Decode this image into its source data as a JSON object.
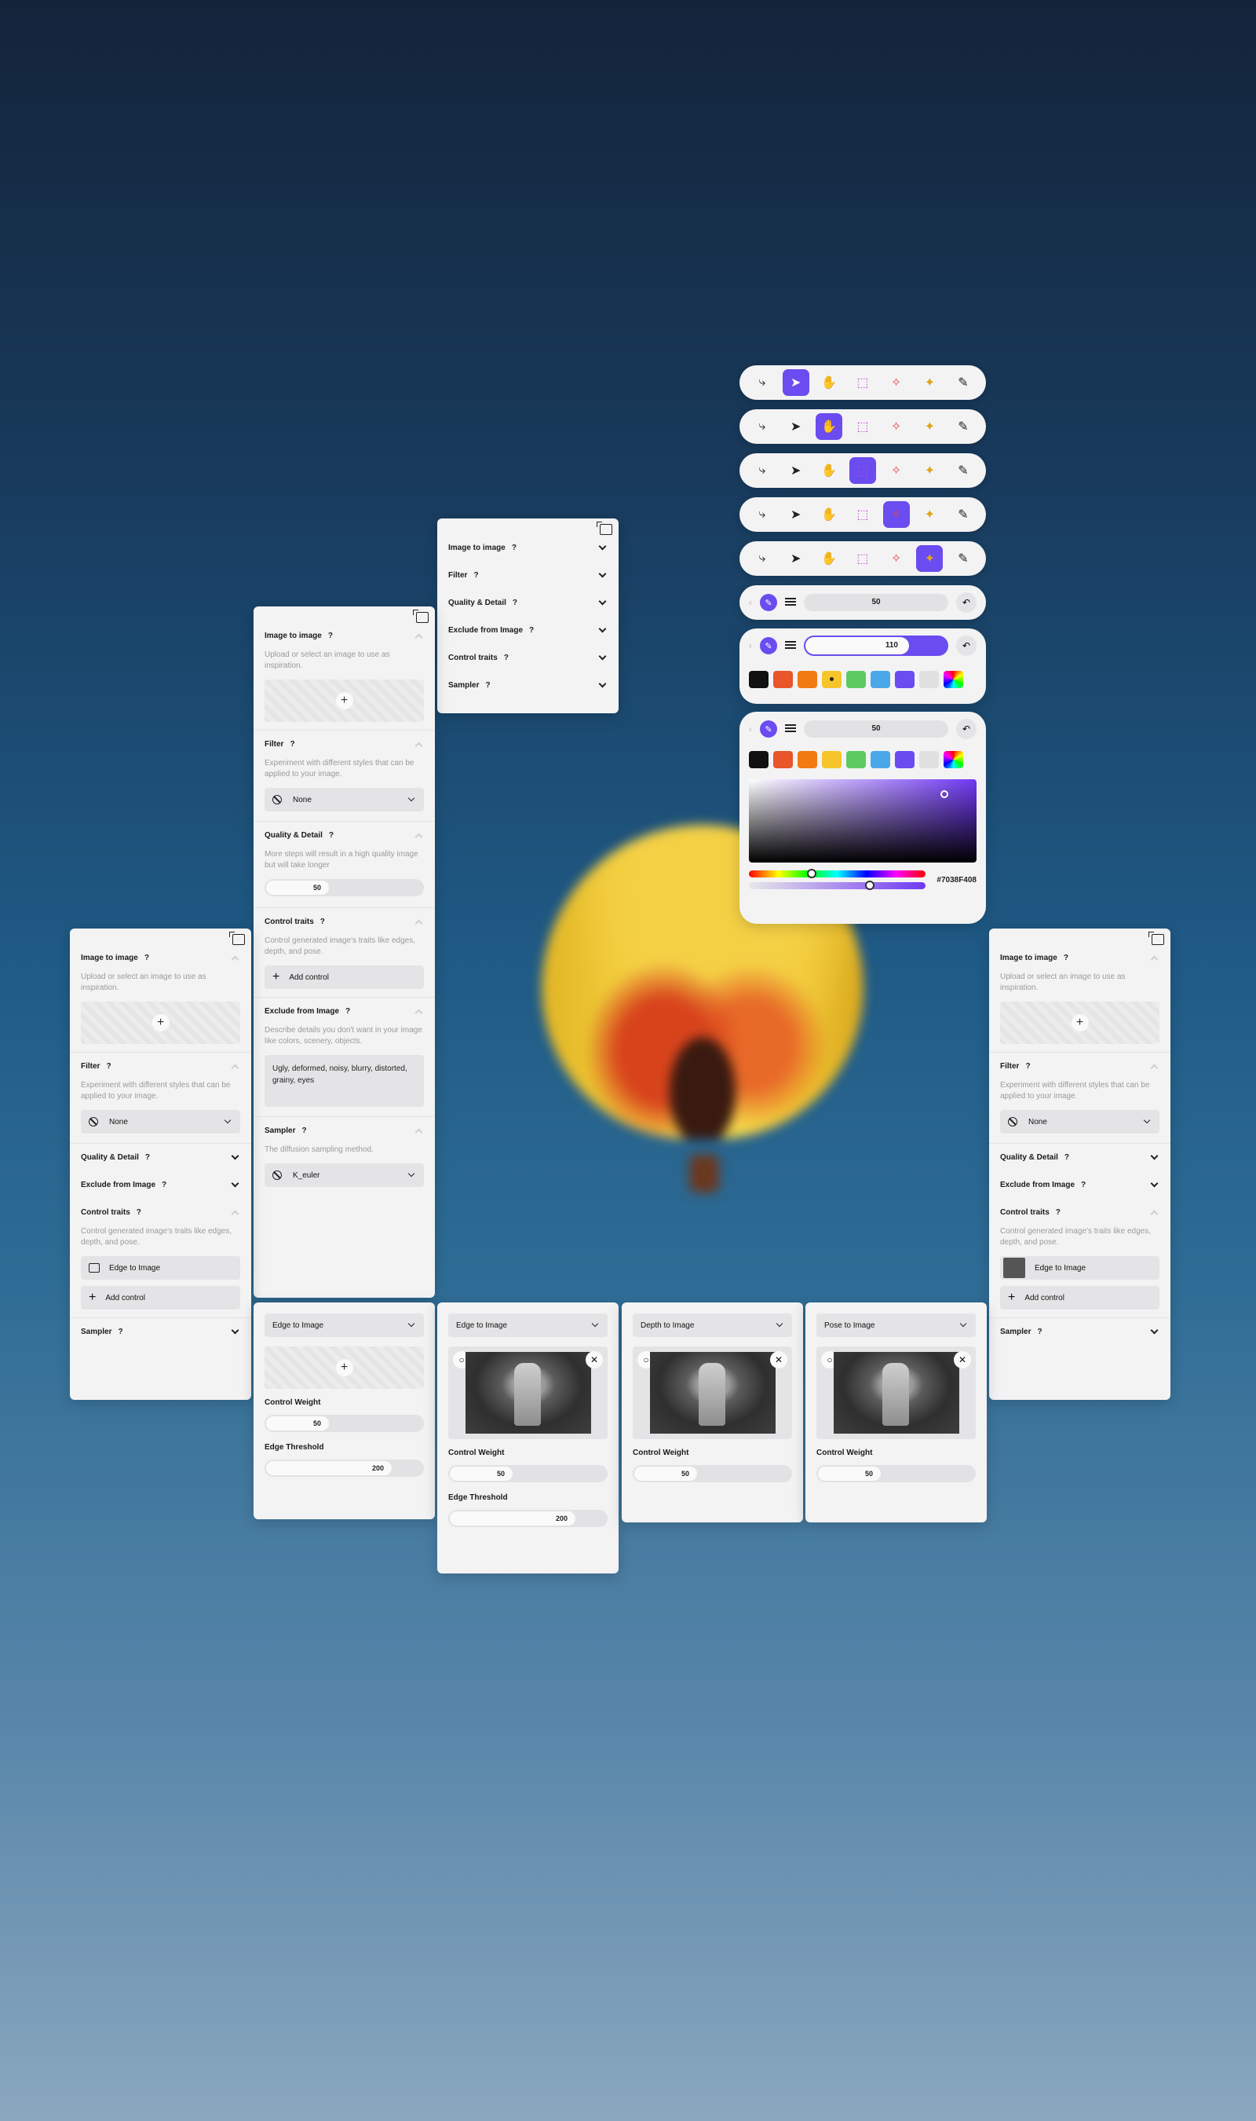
{
  "toolbar": {
    "tool_icons": [
      "scissors-icon",
      "cursor-icon",
      "hand-icon",
      "crop-icon",
      "eraser-icon",
      "magic-wand-icon",
      "pencil-icon"
    ],
    "active_tool_per_row": [
      1,
      2,
      3,
      4,
      5
    ],
    "accent": "#6A4CF0"
  },
  "brush": {
    "size_value": "50",
    "size_value_active": "110",
    "hex": "#7038F408"
  },
  "swatches": [
    "#111111",
    "#E8562A",
    "#F27A12",
    "#F6C52B",
    "#5BCB61",
    "#4AA8E8",
    "#6A4CF0",
    "#E0E0E0"
  ],
  "panel_collapsed": {
    "sections": [
      {
        "title": "Image to image",
        "q": "?"
      },
      {
        "title": "Filter",
        "q": "?"
      },
      {
        "title": "Quality & Detail",
        "q": "?"
      },
      {
        "title": "Exclude from Image",
        "q": "?"
      },
      {
        "title": "Control traits",
        "q": "?"
      },
      {
        "title": "Sampler",
        "q": "?"
      }
    ]
  },
  "panel_expanded": {
    "img2img_title": "Image to image",
    "img2img_desc": "Upload or select an image to use as inspiration.",
    "filter_title": "Filter",
    "filter_desc": "Experiment with different styles that can be applied to your image.",
    "filter_value": "None",
    "quality_title": "Quality & Detail",
    "quality_desc": "More steps will result in a high quality image but will take longer",
    "quality_value": "50",
    "control_title": "Control traits",
    "control_desc": "Control generated image's traits like edges, depth, and pose.",
    "add_control": "Add control",
    "exclude_title": "Exclude from Image",
    "exclude_desc": "Describe details you don't want in your image like colors, scenery, objects.",
    "exclude_text": "Ugly, deformed, noisy, blurry, distorted, grainy, eyes",
    "sampler_title": "Sampler",
    "sampler_desc": "The diffusion sampling method.",
    "sampler_value": "K_euler",
    "q": "?"
  },
  "panel_side": {
    "img2img_title": "Image to image",
    "img2img_desc": "Upload or select an image to use as inspiration.",
    "filter_title": "Filter",
    "filter_desc": "Experiment with different styles that can be applied to your image.",
    "filter_value": "None",
    "quality_title": "Quality & Detail",
    "exclude_title": "Exclude from Image",
    "control_title": "Control traits",
    "control_desc": "Control generated image's traits like edges, depth, and pose.",
    "edge_to_image": "Edge to Image",
    "add_control": "Add control",
    "sampler_title": "Sampler",
    "q": "?"
  },
  "controls": {
    "edge_to_image": "Edge to Image",
    "depth_to_image": "Depth to Image",
    "pose_to_image": "Pose to Image",
    "control_weight": "Control Weight",
    "edge_threshold": "Edge Threshold",
    "weight_value": "50",
    "threshold_value": "200"
  }
}
